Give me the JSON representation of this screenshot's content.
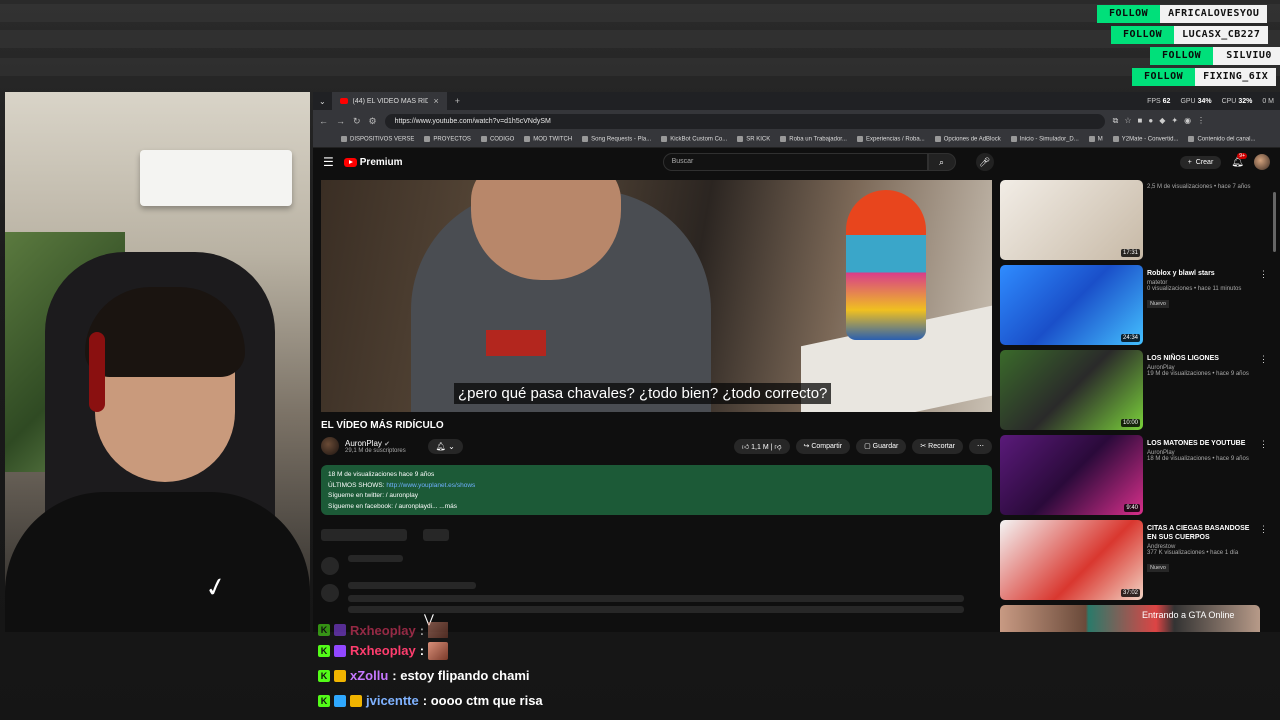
{
  "follows": [
    {
      "label": "FOLLOW",
      "user": "AFRICALOVESYOU"
    },
    {
      "label": "FOLLOW",
      "user": "LUCASX_CB227"
    },
    {
      "label": "FOLLOW",
      "user": "SILVIU0"
    },
    {
      "label": "FOLLOW",
      "user": "FIXING_6IX"
    }
  ],
  "browser": {
    "tab_title": "(44) EL VÍDEO MÁS RIDÍCU",
    "stats": {
      "fps_label": "FPS",
      "fps": "62",
      "gpu_label": "GPU",
      "gpu": "34%",
      "cpu_label": "CPU",
      "cpu": "32%",
      "misc": "0 M"
    },
    "url": "https://www.youtube.com/watch?v=d1h5cVNdySM",
    "bookmarks": [
      "DISPOSITIVOS VERSE",
      "PROYECTOS",
      "CODIGO",
      "MOD TWITCH",
      "Song Requests - Pla...",
      "KickBot Custom Co...",
      "SR KICK",
      "Roba un Trabajador...",
      "Experiencias / Roba...",
      "Opciones de AdBlock",
      "Inicio - Simulador_D...",
      "M",
      "Y2Mate - Convertid...",
      "Contenido del canal..."
    ]
  },
  "youtube": {
    "logo": "Premium",
    "search_placeholder": "Buscar",
    "create_label": "Crear",
    "notif_count": "9+",
    "subtitle": "¿pero qué pasa chavales? ¿todo bien? ¿todo correcto?",
    "video_title": "EL VÍDEO MÁS RIDÍCULO",
    "channel_name": "AuronPlay",
    "channel_subs": "29,1 M de suscriptores",
    "likes": "1,1 M",
    "share": "Compartir",
    "save": "Guardar",
    "clip": "Recortar",
    "description": {
      "line1": "18 M de visualizaciones  hace 9 años",
      "line2_prefix": "ÚLTIMOS SHOWS: ",
      "line2_link": "http://www.youplanet.es/shows",
      "line3": "Sígueme en twitter:  / auronplay",
      "line4": "Sígueme en facebook:  / auronplaydi...  ...más"
    },
    "sidebar": [
      {
        "title": "",
        "channel": "",
        "views": "2,5 M de visualizaciones • hace 7 años",
        "duration": "17:31",
        "new": ""
      },
      {
        "title": "Roblox y blawl stars",
        "channel": "matetor",
        "views": "0 visualizaciones • hace 11 minutos",
        "duration": "24:34",
        "new": "Nuevo"
      },
      {
        "title": "LOS NIÑOS LIGONES",
        "channel": "AuronPlay",
        "views": "19 M de visualizaciones • hace 9 años",
        "duration": "10:00",
        "new": ""
      },
      {
        "title": "LOS MATONES DE YOUTUBE",
        "channel": "AuronPlay",
        "views": "18 M de visualizaciones • hace 9 años",
        "duration": "9:40",
        "new": ""
      },
      {
        "title": "CITAS A CIEGAS BASANDOSE EN SUS CUERPOS",
        "channel": "Andrestow",
        "views": "377 K visualizaciones • hace 1 día",
        "duration": "37:02",
        "new": "Nuevo"
      }
    ]
  },
  "overlay_note": "Entrando a GTA Online",
  "chat": [
    {
      "user": "Rxheoplay",
      "color": "#ff3d6e",
      "msg": ":"
    },
    {
      "user": "Rxheoplay",
      "color": "#ff3d6e",
      "msg": ":"
    },
    {
      "user": "xZollu",
      "color": "#c678ff",
      "msg": ": estoy flipando chami"
    },
    {
      "user": "jvicentte",
      "color": "#7fb2ff",
      "msg": ": oooo ctm que risa"
    }
  ],
  "colors": {
    "follow_green": "#00e07a",
    "yt_red": "#ff0000",
    "desc_green": "#1c5a37",
    "kick_green": "#53fc18"
  },
  "icons": [
    "menu-icon",
    "search-icon",
    "mic-icon",
    "bell-icon",
    "like-icon",
    "dislike-icon",
    "share-icon",
    "save-icon",
    "scissors-icon",
    "kebab-icon"
  ]
}
